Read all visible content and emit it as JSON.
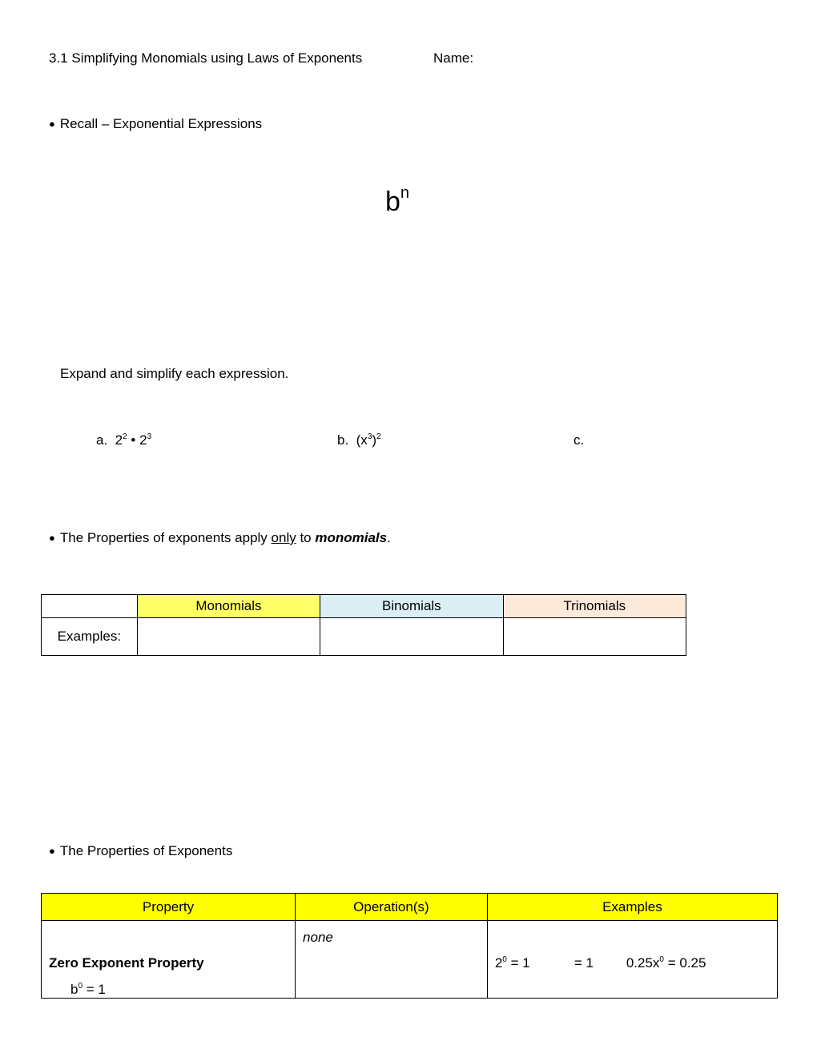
{
  "header": {
    "title": "3.1 Simplifying Monomials using Laws of Exponents",
    "name_label": "Name:"
  },
  "recall": {
    "heading": "Recall – Exponential Expressions",
    "expression_base": "b",
    "expression_exponent": "n"
  },
  "expand": {
    "instruction": "Expand and simplify each expression.",
    "problems": [
      {
        "label": "a.",
        "parts": [
          {
            "base": "2",
            "exp": "2"
          },
          {
            "op": "•"
          },
          {
            "base": "2",
            "exp": "3"
          }
        ]
      },
      {
        "label": "b.",
        "text_before": "(x",
        "inner_exp": "3",
        "text_mid": ")",
        "outer_exp": "2"
      },
      {
        "label": "c.",
        "text": ""
      }
    ]
  },
  "monomials_note": {
    "prefix": "The Properties of exponents apply ",
    "underlined": "only",
    "middle": " to ",
    "emphasis": "monomials",
    "suffix": "."
  },
  "poly_table": {
    "headers": [
      "",
      "Monomials",
      "Binomials",
      "Trinomials"
    ],
    "header_colors": [
      "#ffffff",
      "#ffff66",
      "#daeef3",
      "#fde9d9"
    ],
    "row_label": "Examples:",
    "cells": [
      "",
      "",
      ""
    ]
  },
  "properties": {
    "heading": "The Properties of Exponents",
    "table": {
      "headers": [
        "Property",
        "Operation(s)",
        "Examples"
      ],
      "header_color": "#ffff00",
      "rows": [
        {
          "property_name": "Zero Exponent Property",
          "rule_base": "b",
          "rule_exp": "0",
          "rule_rest": " = 1",
          "operation": "none",
          "ex1_base": "2",
          "ex1_exp": "0",
          "ex1_rest": " =  1",
          "ex2": "=  1",
          "ex3_base": "0.25x",
          "ex3_exp": "0",
          "ex3_rest": " =   0.25"
        }
      ]
    }
  }
}
